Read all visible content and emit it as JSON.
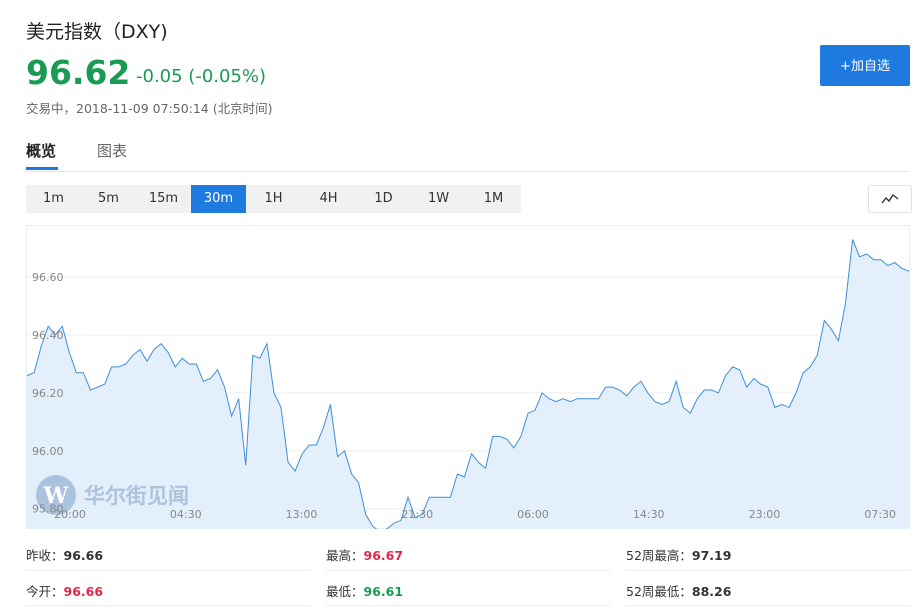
{
  "header": {
    "title": "美元指数（DXY)",
    "price": "96.62",
    "change": "-0.05 (-0.05%)",
    "status": "交易中，2018-11-09 07:50:14 (北京时间)",
    "add_button": "+加自选"
  },
  "colors": {
    "accent": "#1f7ae0",
    "up": "#e0284a",
    "down": "#1a9b55",
    "line": "#3f8fd8",
    "fill": "#e3effb"
  },
  "tabs": [
    "概览",
    "图表"
  ],
  "intervals": [
    "1m",
    "5m",
    "15m",
    "30m",
    "1H",
    "4H",
    "1D",
    "1W",
    "1M"
  ],
  "active_interval": "30m",
  "chart_type_icon": "line-chart-icon",
  "watermark": "华尔街见闻",
  "chart_data": {
    "type": "area",
    "title": "",
    "xlabel": "",
    "ylabel": "",
    "ylim": [
      95.73,
      96.78
    ],
    "yticks": [
      "96.60",
      "96.40",
      "96.20",
      "96.00",
      "95.80"
    ],
    "xticks": [
      "20:00",
      "04:30",
      "13:00",
      "21:30",
      "06:00",
      "14:30",
      "23:00",
      "07:30"
    ],
    "grid": true,
    "values": [
      96.26,
      96.27,
      96.36,
      96.43,
      96.4,
      96.43,
      96.34,
      96.27,
      96.27,
      96.21,
      96.22,
      96.23,
      96.29,
      96.29,
      96.3,
      96.33,
      96.35,
      96.31,
      96.35,
      96.37,
      96.34,
      96.29,
      96.32,
      96.3,
      96.3,
      96.24,
      96.25,
      96.28,
      96.22,
      96.12,
      96.18,
      95.95,
      96.33,
      96.32,
      96.37,
      96.2,
      96.15,
      95.96,
      95.93,
      95.99,
      96.02,
      96.02,
      96.08,
      96.16,
      95.98,
      96.0,
      95.92,
      95.89,
      95.78,
      95.74,
      95.72,
      95.73,
      95.75,
      95.76,
      95.84,
      95.77,
      95.78,
      95.84,
      95.84,
      95.84,
      95.84,
      95.92,
      95.91,
      95.99,
      95.96,
      95.94,
      96.05,
      96.05,
      96.04,
      96.01,
      96.05,
      96.13,
      96.14,
      96.2,
      96.18,
      96.17,
      96.18,
      96.17,
      96.18,
      96.18,
      96.18,
      96.18,
      96.22,
      96.22,
      96.21,
      96.19,
      96.22,
      96.24,
      96.2,
      96.17,
      96.16,
      96.17,
      96.24,
      96.15,
      96.13,
      96.18,
      96.21,
      96.21,
      96.2,
      96.26,
      96.29,
      96.28,
      96.22,
      96.25,
      96.23,
      96.22,
      96.15,
      96.16,
      96.15,
      96.2,
      96.27,
      96.29,
      96.33,
      96.45,
      96.42,
      96.38,
      96.51,
      96.73,
      96.67,
      96.68,
      96.66,
      96.66,
      96.64,
      96.65,
      96.63,
      96.62
    ]
  },
  "stats": {
    "prev_close_label": "昨收：",
    "prev_close": "96.66",
    "high_label": "最高：",
    "high": "96.67",
    "wk52_high_label": "52周最高：",
    "wk52_high": "97.19",
    "open_label": "今开：",
    "open": "96.66",
    "low_label": "最低：",
    "low": "96.61",
    "wk52_low_label": "52周最低：",
    "wk52_low": "88.26"
  }
}
